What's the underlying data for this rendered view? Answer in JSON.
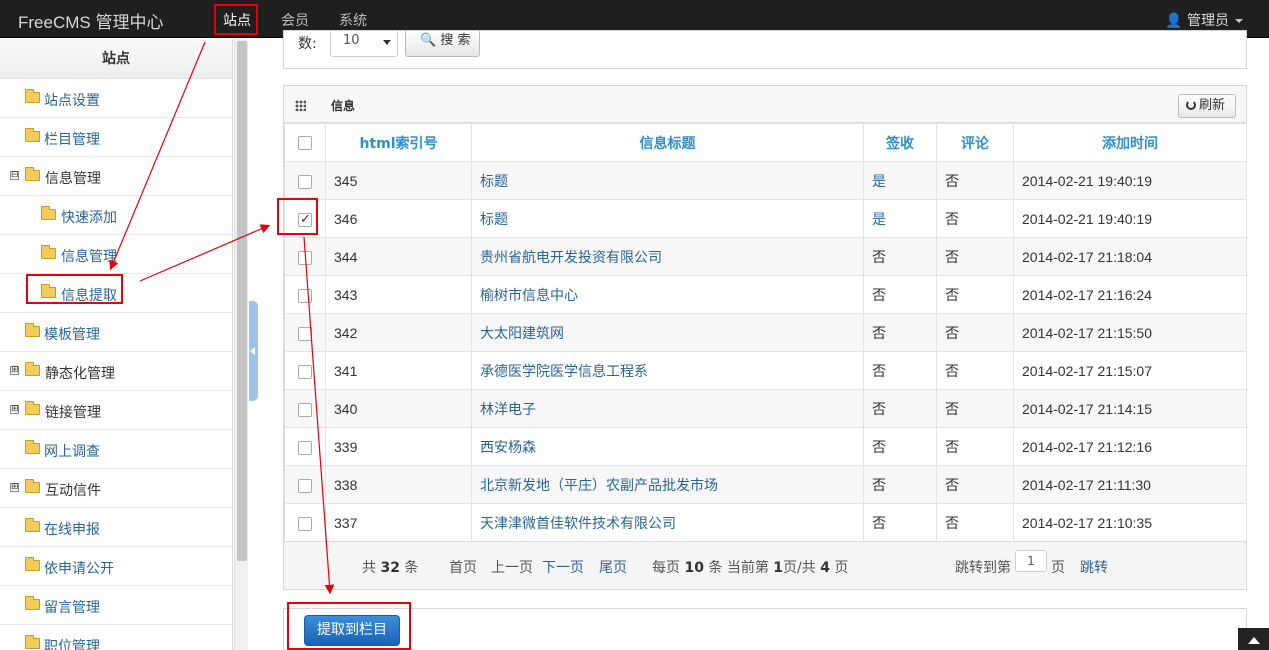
{
  "navbar": {
    "brand": "FreeCMS 管理中心",
    "items": [
      {
        "label": "站点",
        "active": true
      },
      {
        "label": "会员",
        "active": false
      },
      {
        "label": "系统",
        "active": false
      }
    ],
    "user": "管理员"
  },
  "sidebar": {
    "title": "站点",
    "items": [
      {
        "label": "站点设置"
      },
      {
        "label": "栏目管理"
      },
      {
        "label": "信息管理",
        "toggle": "⊟"
      },
      {
        "label": "快速添加"
      },
      {
        "label": "信息管理"
      },
      {
        "label": "信息提取"
      },
      {
        "label": "模板管理"
      },
      {
        "label": "静态化管理",
        "toggle": "⊞"
      },
      {
        "label": "链接管理",
        "toggle": "⊞"
      },
      {
        "label": "网上调查"
      },
      {
        "label": "互动信件",
        "toggle": "⊞"
      },
      {
        "label": "在线申报"
      },
      {
        "label": "依申请公开"
      },
      {
        "label": "留言管理"
      },
      {
        "label": "职位管理"
      }
    ]
  },
  "search": {
    "page_size_label": "数:",
    "page_size_value": "10",
    "search_button": "搜 索"
  },
  "panel": {
    "title": "信息",
    "refresh_button": "刷新"
  },
  "table": {
    "columns": [
      "html索引号",
      "信息标题",
      "签收",
      "评论",
      "添加时间"
    ],
    "rows": [
      {
        "id": "345",
        "title": "标题",
        "signed": "是",
        "comment": "否",
        "time": "2014-02-21 19:40:19",
        "checked": false
      },
      {
        "id": "346",
        "title": "标题",
        "signed": "是",
        "comment": "否",
        "time": "2014-02-21 19:40:19",
        "checked": true
      },
      {
        "id": "344",
        "title": "贵州省航电开发投资有限公司",
        "signed": "否",
        "comment": "否",
        "time": "2014-02-17 21:18:04",
        "checked": false
      },
      {
        "id": "343",
        "title": "榆树市信息中心",
        "signed": "否",
        "comment": "否",
        "time": "2014-02-17 21:16:24",
        "checked": false
      },
      {
        "id": "342",
        "title": "大太阳建筑网",
        "signed": "否",
        "comment": "否",
        "time": "2014-02-17 21:15:50",
        "checked": false
      },
      {
        "id": "341",
        "title": "承德医学院医学信息工程系",
        "signed": "否",
        "comment": "否",
        "time": "2014-02-17 21:15:07",
        "checked": false
      },
      {
        "id": "340",
        "title": "林洋电子",
        "signed": "否",
        "comment": "否",
        "time": "2014-02-17 21:14:15",
        "checked": false
      },
      {
        "id": "339",
        "title": "西安杨森",
        "signed": "否",
        "comment": "否",
        "time": "2014-02-17 21:12:16",
        "checked": false
      },
      {
        "id": "338",
        "title": "北京新发地（平庄）农副产品批发市场",
        "signed": "否",
        "comment": "否",
        "time": "2014-02-17 21:11:30",
        "checked": false
      },
      {
        "id": "337",
        "title": "天津津微首佳软件技术有限公司",
        "signed": "否",
        "comment": "否",
        "time": "2014-02-17 21:10:35",
        "checked": false
      }
    ]
  },
  "pager": {
    "total_prefix": "共",
    "total": "32",
    "total_suffix": "条",
    "first": "首页",
    "prev": "上一页",
    "next": "下一页",
    "last": "尾页",
    "per_page_prefix": "每页",
    "per_page": "10",
    "per_page_mid": "条 当前第",
    "current": "1",
    "of": "页/共",
    "pages": "4",
    "pages_suffix": "页",
    "jump_prefix": "跳转到第",
    "jump_value": "1",
    "jump_suffix": "页",
    "jump_button": "跳转"
  },
  "actions": {
    "extract_button": "提取到栏目"
  },
  "colors": {
    "navbar_bg": "#1f1f1f",
    "link": "#2a6496",
    "header_text": "#2f8fcf",
    "primary_button": "#1862b5",
    "annotation": "#e8000b"
  }
}
